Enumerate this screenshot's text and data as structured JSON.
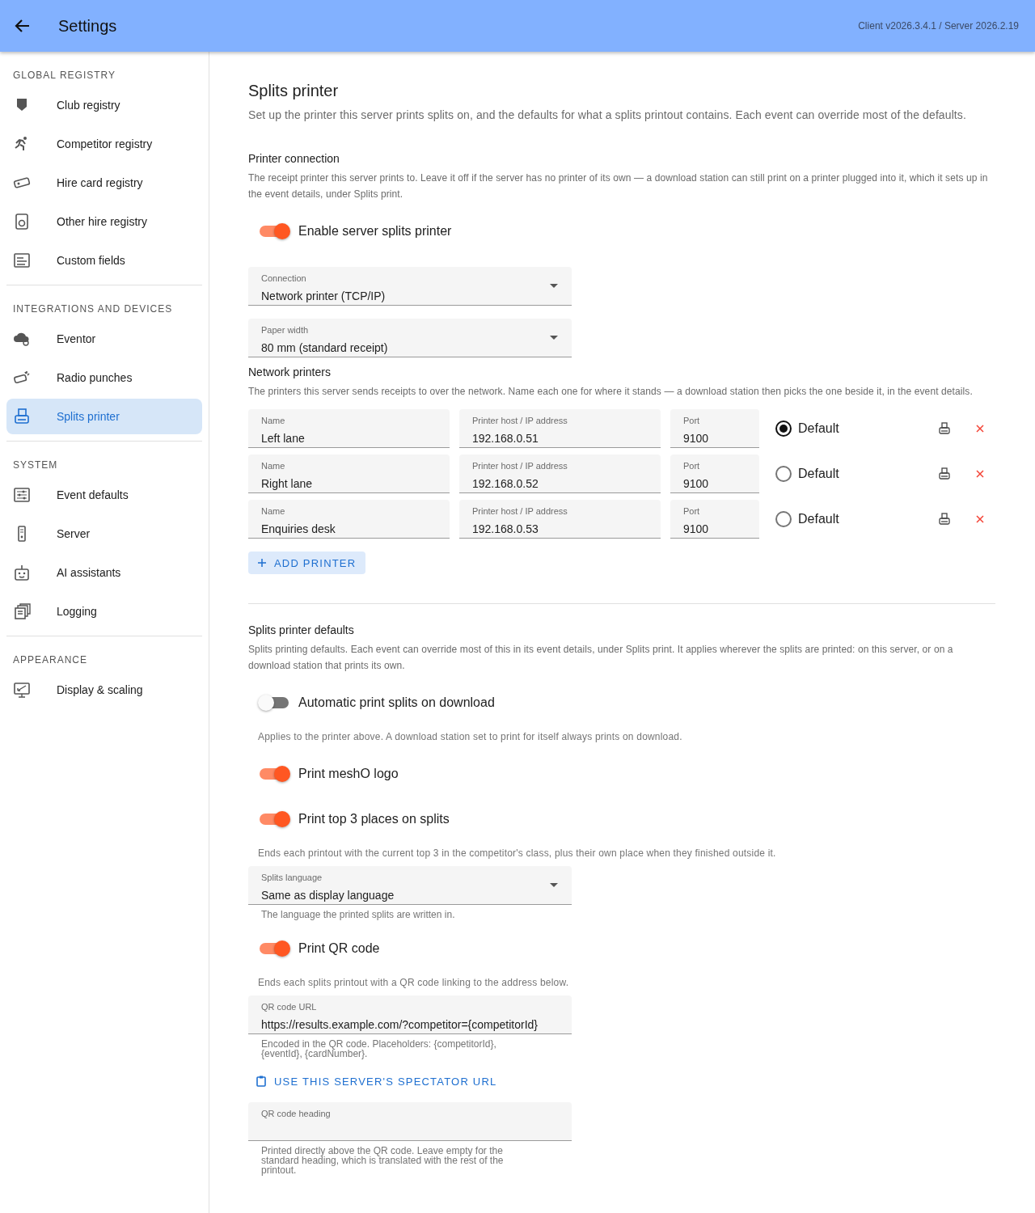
{
  "header": {
    "title": "Settings",
    "version": "Client v2026.3.4.1 / Server 2026.2.19"
  },
  "sidebar": {
    "sections": [
      {
        "heading": "GLOBAL REGISTRY",
        "items": [
          {
            "label": "Club registry",
            "selected": false
          },
          {
            "label": "Competitor registry",
            "selected": false
          },
          {
            "label": "Hire card registry",
            "selected": false
          },
          {
            "label": "Other hire registry",
            "selected": false
          },
          {
            "label": "Custom fields",
            "selected": false
          }
        ]
      },
      {
        "heading": "INTEGRATIONS AND DEVICES",
        "items": [
          {
            "label": "Eventor",
            "selected": false
          },
          {
            "label": "Radio punches",
            "selected": false
          },
          {
            "label": "Splits printer",
            "selected": true
          }
        ]
      },
      {
        "heading": "SYSTEM",
        "items": [
          {
            "label": "Event defaults",
            "selected": false
          },
          {
            "label": "Server",
            "selected": false
          },
          {
            "label": "AI assistants",
            "selected": false
          },
          {
            "label": "Logging",
            "selected": false
          }
        ]
      },
      {
        "heading": "APPEARANCE",
        "items": [
          {
            "label": "Display & scaling",
            "selected": false
          }
        ]
      }
    ]
  },
  "page": {
    "title": "Splits printer",
    "description": "Set up the printer this server prints splits on, and the defaults for what a splits printout contains. Each event can override most of the defaults.",
    "sections": [
      {
        "heading": "Printer connection",
        "separated": false,
        "description": "The receipt printer this server prints to. Leave it off if the server has no printer of its own — a download station can still print on a printer plugged into it, which it sets up in the event details, under Splits print.",
        "items": [
          {
            "kind": "toggle",
            "label": "Enable server splits printer",
            "on": true
          },
          {
            "kind": "select",
            "label": "Connection",
            "value": "Network printer (TCP/IP)"
          },
          {
            "kind": "select",
            "label": "Paper width",
            "value": "80 mm (standard receipt)"
          }
        ]
      },
      {
        "heading": "Network printers",
        "separated": false,
        "description": "The printers this server sends receipts to over the network. Name each one for where it stands — a download station then picks the one beside it, in the event details.",
        "items": [
          {
            "kind": "printer",
            "name_label": "Name",
            "name": "Left lane",
            "host_label": "Printer host / IP address",
            "host": "192.168.0.51",
            "port_label": "Port",
            "port": "9100",
            "radio_label": "Default",
            "selected": true
          },
          {
            "kind": "printer",
            "name_label": "Name",
            "name": "Right lane",
            "host_label": "Printer host / IP address",
            "host": "192.168.0.52",
            "port_label": "Port",
            "port": "9100",
            "radio_label": "Default",
            "selected": false
          },
          {
            "kind": "printer",
            "name_label": "Name",
            "name": "Enquiries desk",
            "host_label": "Printer host / IP address",
            "host": "192.168.0.53",
            "port_label": "Port",
            "port": "9100",
            "radio_label": "Default",
            "selected": false
          },
          {
            "kind": "add-button",
            "label": "ADD PRINTER"
          }
        ]
      },
      {
        "heading": "Splits printer defaults",
        "separated": true,
        "description": "Splits printing defaults. Each event can override most of this in its event details, under Splits print. It applies wherever the splits are printed: on this server, or on a download station that prints its own.",
        "items": [
          {
            "kind": "toggle",
            "label": "Automatic print splits on download",
            "on": false
          },
          {
            "kind": "hint",
            "text": "Applies to the printer above. A download station set to print for itself always prints on download."
          },
          {
            "kind": "toggle",
            "label": "Print meshO logo",
            "on": true
          },
          {
            "kind": "toggle",
            "label": "Print top 3 places on splits",
            "on": true
          },
          {
            "kind": "hint",
            "text": "Ends each printout with the current top 3 in the competitor's class, plus their own place when they finished outside it."
          },
          {
            "kind": "select",
            "label": "Splits language",
            "value": "Same as display language",
            "helper": "The language the printed splits are written in."
          },
          {
            "kind": "toggle",
            "label": "Print QR code",
            "on": true
          },
          {
            "kind": "hint",
            "text": "Ends each splits printout with a QR code linking to the address below."
          },
          {
            "kind": "field",
            "label": "QR code URL",
            "value": "https://results.example.com/?competitor={competitorId}",
            "helper": "Encoded in the QR code. Placeholders: {competitorId}, {eventId}, {cardNumber}."
          },
          {
            "kind": "link-button",
            "label": "USE THIS SERVER'S SPECTATOR URL"
          },
          {
            "kind": "field",
            "label": "QR code heading",
            "helper": "Printed directly above the QR code. Leave empty for the standard heading, which is translated with the rest of the printout."
          }
        ]
      }
    ]
  }
}
